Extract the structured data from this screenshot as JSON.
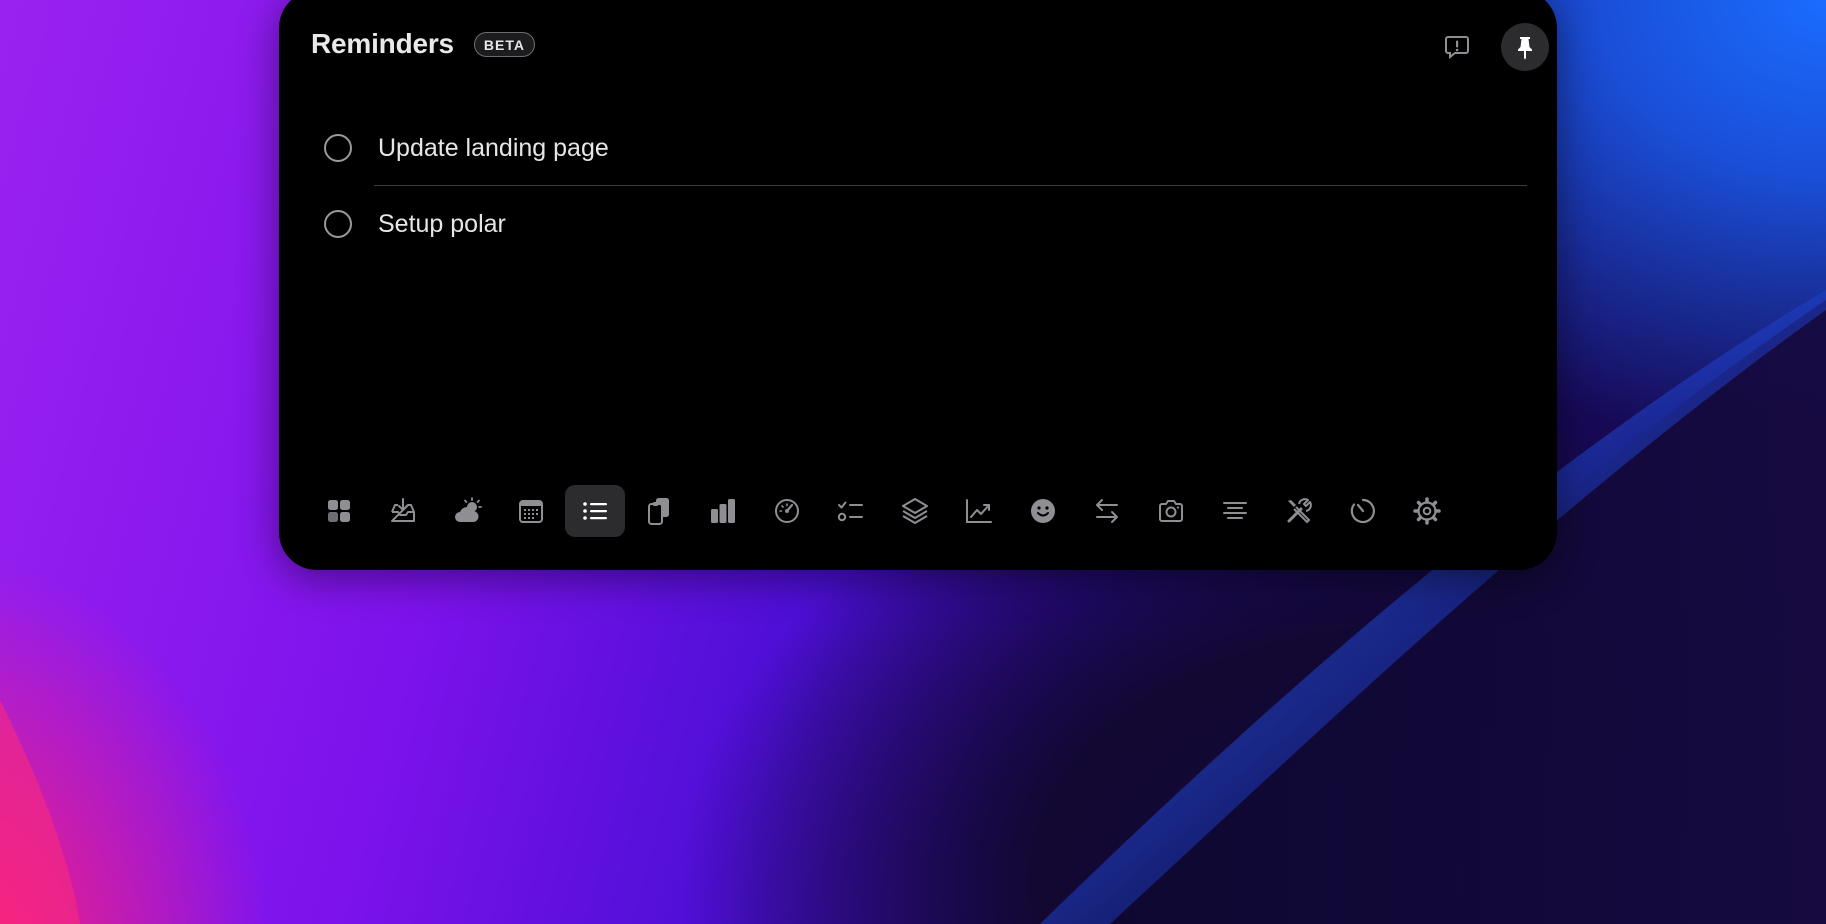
{
  "widget": {
    "title": "Reminders",
    "badge": "BETA"
  },
  "header_actions": [
    {
      "name": "feedback",
      "icon": "feedback-bubble-icon"
    },
    {
      "name": "pin",
      "icon": "pin-icon",
      "active": true
    }
  ],
  "reminders": [
    {
      "label": "Update landing page",
      "completed": false
    },
    {
      "label": "Setup polar",
      "completed": false
    }
  ],
  "toolbar": {
    "active_index": 4,
    "tools": [
      {
        "icon": "widgets-grid-icon"
      },
      {
        "icon": "inbox-download-icon"
      },
      {
        "icon": "weather-icon"
      },
      {
        "icon": "calendar-icon"
      },
      {
        "icon": "list-icon"
      },
      {
        "icon": "clipboard-icon"
      },
      {
        "icon": "bar-chart-icon"
      },
      {
        "icon": "speedometer-icon"
      },
      {
        "icon": "checklist-icon"
      },
      {
        "icon": "layers-icon"
      },
      {
        "icon": "line-chart-icon"
      },
      {
        "icon": "emoji-icon"
      },
      {
        "icon": "arrows-swap-icon"
      },
      {
        "icon": "camera-icon"
      },
      {
        "icon": "text-align-center-icon"
      },
      {
        "icon": "tools-icon"
      },
      {
        "icon": "timer-icon"
      },
      {
        "icon": "settings-gear-icon"
      }
    ]
  },
  "colors": {
    "panel_bg": "#000000",
    "text_primary": "#e6e6e8",
    "icon_gray": "#8e8e93",
    "active_tool_bg": "#2c2c2e"
  }
}
